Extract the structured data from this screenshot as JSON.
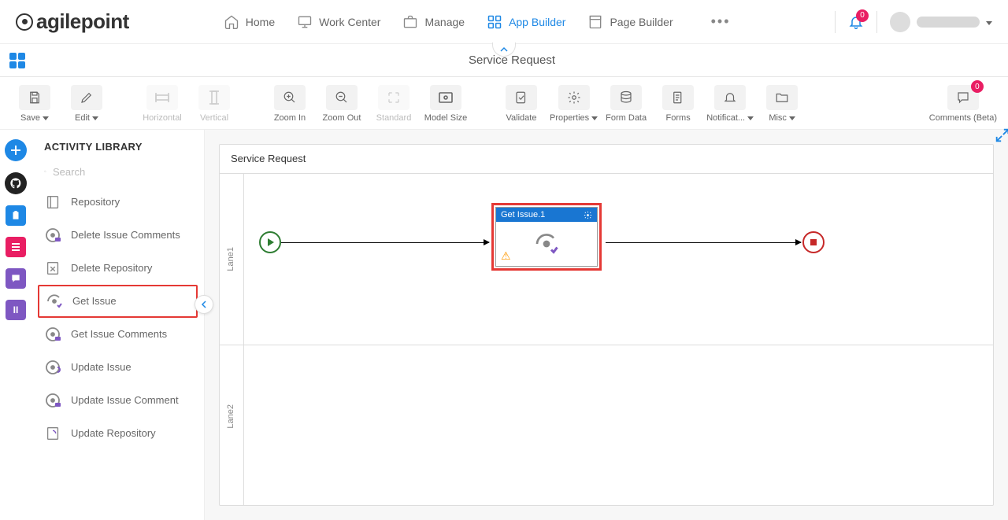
{
  "nav": {
    "home": "Home",
    "work_center": "Work Center",
    "manage": "Manage",
    "app_builder": "App Builder",
    "page_builder": "Page Builder",
    "more": "•••",
    "notif_count": "0"
  },
  "page": {
    "title": "Service Request"
  },
  "toolbar": {
    "save": "Save",
    "edit": "Edit",
    "horizontal": "Horizontal",
    "vertical": "Vertical",
    "zoom_in": "Zoom In",
    "zoom_out": "Zoom Out",
    "standard": "Standard",
    "model_size": "Model Size",
    "validate": "Validate",
    "properties": "Properties",
    "form_data": "Form Data",
    "forms": "Forms",
    "notifications": "Notificat...",
    "misc": "Misc",
    "comments": "Comments (Beta)",
    "comments_count": "0"
  },
  "sidebar": {
    "title": "ACTIVITY LIBRARY",
    "search_placeholder": "Search",
    "items": [
      "Repository",
      "Delete Issue Comments",
      "Delete Repository",
      "Get Issue",
      "Get Issue Comments",
      "Update Issue",
      "Update Issue Comment",
      "Update Repository"
    ]
  },
  "canvas": {
    "title": "Service Request",
    "lane1": "Lane1",
    "lane2": "Lane2",
    "activity_node": {
      "title": "Get Issue.1",
      "gear": "✿"
    }
  }
}
